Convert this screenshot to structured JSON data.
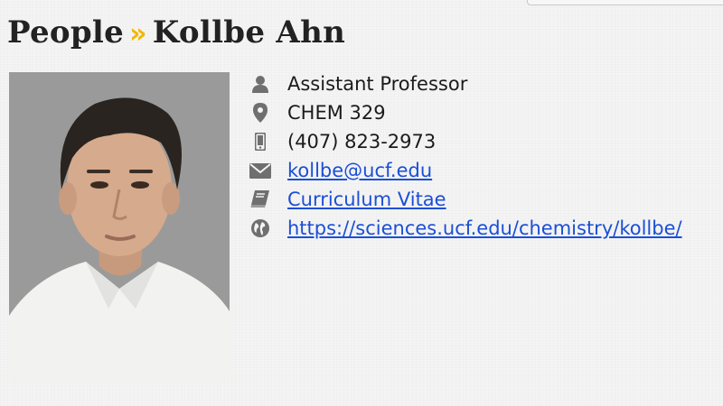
{
  "header": {
    "section": "People",
    "separator": "»",
    "name": "Kollbe Ahn"
  },
  "profile": {
    "photo_icon": "person-photo",
    "title": "Assistant Professor",
    "office": "CHEM 329",
    "phone": "(407) 823-2973",
    "email": "kollbe@ucf.edu",
    "cv_label": "Curriculum Vitae",
    "website": "https://sciences.ucf.edu/chemistry/kollbe/"
  },
  "icons": {
    "title": "user-icon",
    "office": "map-marker-icon",
    "phone": "mobile-phone-icon",
    "email": "envelope-icon",
    "cv": "book-icon",
    "website": "globe-icon"
  },
  "colors": {
    "accent": "#f3b600",
    "link": "#1a4fd6",
    "icon": "#6f6f6f"
  }
}
